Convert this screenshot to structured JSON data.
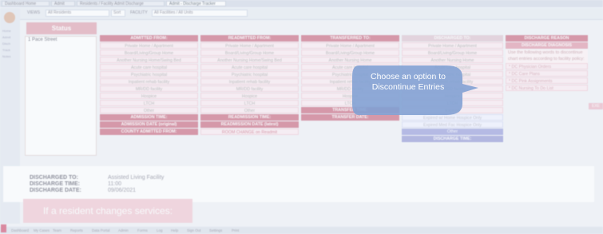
{
  "tabs": [
    {
      "label": "Dashboard Home",
      "active": false
    },
    {
      "label": "Admit",
      "active": false
    },
    {
      "label": "Residents / Facility Admit Discharge",
      "active": false
    },
    {
      "label": "Admit - Discharge Tracker",
      "active": true
    }
  ],
  "toolbar": {
    "filter1_label": "VIEWS",
    "filter1_value": "All Residents",
    "filter2_label": "FACILITY",
    "filter2_value": "All Facilities / All Units",
    "extra_box": "Sort"
  },
  "sidebar": {
    "items": [
      "Home",
      "Admit",
      "Disch",
      "Track",
      "Notes"
    ]
  },
  "status": {
    "header": "Status",
    "value": "1 Pace Street"
  },
  "columns": [
    {
      "header": "ADMITTED FROM:",
      "options": [
        "Private Home / Apartment",
        "Board/Living/Group Home",
        "Another Nursing Home/Swing Bed",
        "Acute care hospital",
        "Psychiatric hospital",
        "Inpatient rehab facility",
        "MR/DD facility",
        "Hospice",
        "LTCH",
        "Other"
      ],
      "footers": [
        {
          "text": "ADMISSION TIME:",
          "style": "hdr"
        },
        {
          "text": "ADMISSION DATE (original)",
          "style": "hdr"
        },
        {
          "text": "COUNTY ADMITTED FROM:",
          "style": "hdr"
        }
      ]
    },
    {
      "header": "READMITTED FROM:",
      "options": [
        "Private Home / Apartment",
        "Board/Living/Group Home",
        "Another Nursing Home/Swing Bed",
        "Acute care hospital",
        "Psychiatric hospital",
        "Inpatient rehab facility",
        "MR/DD facility",
        "Hospice",
        "LTCH",
        "Other"
      ],
      "footers": [
        {
          "text": "READMISSION TIME:",
          "style": "hdr"
        },
        {
          "text": "READMISSION DATE (latest)",
          "style": "hdr"
        },
        {
          "text": "ROOM CHANGE on Readmit",
          "style": "fopt"
        }
      ]
    },
    {
      "header": "TRANSFERRED TO:",
      "options": [
        "Private Home / Apartment",
        "Board/Living/Group Home",
        "Another Nursing Home",
        "Acute care hospital",
        "Psychiatric hospital",
        "Inpatient rehab facility",
        "MR/DD facility",
        "Hospice",
        "LTCH"
      ],
      "footers": [
        {
          "text": "TRANSFER TIME:",
          "style": "hdr"
        },
        {
          "text": "TRANSFER DATE:",
          "style": "hdr"
        }
      ]
    },
    {
      "header": "DISCHARGED TO:",
      "options": [
        "Private Home / Apartment",
        "Board/Living/Group Home",
        "Another Nursing Home",
        "Acute care hospital",
        "Psychiatric hospital",
        "Inpatient rehab facility",
        "MR/DD facility",
        "Hospice",
        "LTCH",
        "Expired"
      ],
      "footers": [
        {
          "text": "Expired w/ Home Hospice Only",
          "style": "bopt"
        },
        {
          "text": "Expired Med Fac Hospice Only",
          "style": "bopt"
        },
        {
          "text": "Other",
          "style": "bsel"
        },
        {
          "text": "DISCHARGE TIME:",
          "style": "bhdr"
        }
      ]
    }
  ],
  "reason": {
    "header": "DISCHARGE REASON",
    "subheader": "DISCHARGE DIAGNOSIS",
    "instructions": "Use the following words to discontinue chart entries according to facility policy:",
    "list": [
      "* DC Physician Orders",
      "* DC Care Plans",
      "* DC Pink Assignments",
      "* DC Nursing To Do List"
    ],
    "button": "EXE"
  },
  "tooltip": {
    "text": "Choose an option to Discontinue Entries"
  },
  "summary": {
    "rows": [
      {
        "label": "DISCHARGED TO:",
        "value": "Assisted Living Facility"
      },
      {
        "label": "DISCHARGE TIME:",
        "value": "11:00"
      },
      {
        "label": "DISCHARGE DATE:",
        "value": "09/06/2021"
      }
    ]
  },
  "banner": {
    "text": "If a resident changes services:"
  },
  "taskbar": [
    "Dashboard",
    "My Cases",
    "Team",
    "Reports",
    "Data Portal",
    "Admin",
    "Forms",
    "Log",
    "Help",
    "Sign Out",
    "Settings",
    "Print"
  ]
}
